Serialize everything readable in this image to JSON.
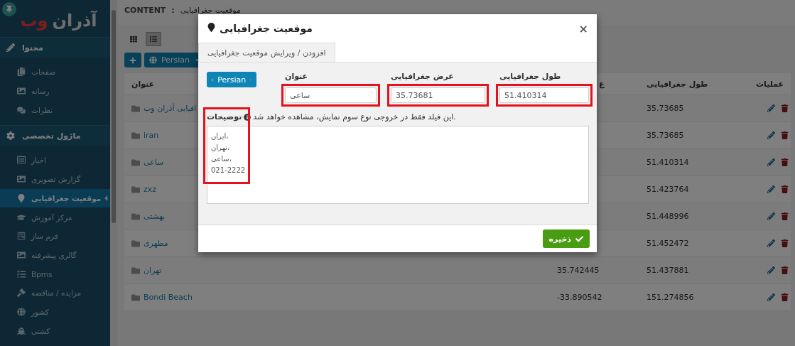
{
  "sidebar": {
    "logo": {
      "part_1": "آذران",
      "part_2": "وب"
    },
    "sections": [
      {
        "title": "محتوا",
        "items": [
          {
            "label": "صفحات",
            "selected": false
          },
          {
            "label": "رسانه",
            "selected": false
          },
          {
            "label": "نظرات",
            "selected": false
          }
        ]
      },
      {
        "title": "ماژول تخصصی",
        "items": [
          {
            "label": "اخبار",
            "selected": false
          },
          {
            "label": "گزارش تصویری",
            "selected": false
          },
          {
            "label": "موقعیت جغرافیایی",
            "selected": true
          },
          {
            "label": "مرکز آموزش",
            "selected": false
          },
          {
            "label": "فرم ساز",
            "selected": false
          },
          {
            "label": "گالری پیشرفته",
            "selected": false
          },
          {
            "label": "Bpms",
            "selected": false
          },
          {
            "label": "مزایده / مناقصه",
            "selected": false
          },
          {
            "label": "کشور",
            "selected": false
          },
          {
            "label": "کشتی",
            "selected": false
          }
        ]
      }
    ]
  },
  "breadcrumb": {
    "root": "CONTENT",
    "separator": ":",
    "page": "موقعیت جغرافیایی"
  },
  "toolbar": {
    "views": [
      {
        "selected": false
      },
      {
        "selected": true
      }
    ],
    "language_button": "Persian"
  },
  "table": {
    "columns": [
      "عملیات",
      "طول جغرافیایی",
      "ع",
      "عنوان"
    ],
    "rows": [
      {
        "title": "افیایی آذران وب",
        "longitude": "35.73685"
      },
      {
        "title": "iran",
        "longitude": "35.73685"
      },
      {
        "title": "ساعی",
        "longitude": "51.410314"
      },
      {
        "title": "zxz",
        "longitude": "51.423764"
      },
      {
        "title": "بهشتی",
        "longitude": "51.448996"
      },
      {
        "title": "مطهری",
        "longitude": "51.452472"
      },
      {
        "title": "تهران",
        "latitude": "35.742445",
        "longitude": "51.437881"
      },
      {
        "title": "Bondi Beach",
        "latitude": "-33.890542",
        "longitude": "151.274856"
      }
    ]
  },
  "modal": {
    "title": "موقعیت جغرافیایی",
    "close": "×",
    "tabs": [
      {
        "label": "افزودن / ویرایش موقعیت جغرافیایی",
        "selected": true
      }
    ],
    "language_button": "Persian",
    "fields": [
      {
        "label": "طول جغرافیایی",
        "value": "51.410314",
        "highlighted": true
      },
      {
        "label": "عرض جغرافیایی",
        "value": "35.73681",
        "highlighted": true
      },
      {
        "label": "عنوان",
        "value": "ساعی",
        "highlighted": true
      }
    ],
    "description": {
      "label": "توضیحات",
      "hint": "این فیلد فقط در خروجی نوع سوم نمایش، مشاهده خواهد شد.",
      "lines": [
        "ایران،",
        "تهران،",
        "ساعی،",
        "021-2222"
      ],
      "highlighted": true
    },
    "save_button": "ذخیره"
  }
}
